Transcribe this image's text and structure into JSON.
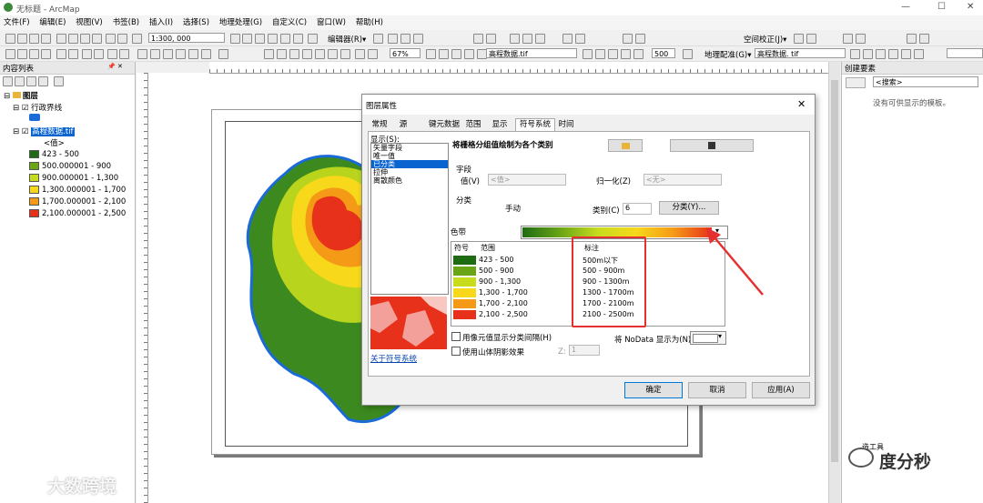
{
  "window": {
    "title": "无标题 - ArcMap",
    "minimize": "—",
    "maximize": "☐",
    "close": "✕"
  },
  "menu": [
    "文件(F)",
    "编辑(E)",
    "视图(V)",
    "书签(B)",
    "插入(I)",
    "选择(S)",
    "地理处理(G)",
    "自定义(C)",
    "窗口(W)",
    "帮助(H)"
  ],
  "toolbar": {
    "scale": "1:300, 000",
    "editor_label": "编辑器(R)▾",
    "spatial_adjust": "空间校正(J)▾",
    "zoom": "67%",
    "raster_layer": "高程数据.tif",
    "num_value": "500",
    "georef_label": "地理配准(G)▾",
    "georef_layer": "高程数据. tif"
  },
  "toc": {
    "title": "内容列表",
    "pin": "📌 ✕",
    "layers_root": "图层",
    "layer1": "行政界线",
    "layer2": "高程数据.tif",
    "value_label": "<值>",
    "classes": [
      {
        "label": "423 - 500",
        "color": "#1e6b14"
      },
      {
        "label": "500.000001 - 900",
        "color": "#6aa516"
      },
      {
        "label": "900.000001 - 1,300",
        "color": "#c8dc1e"
      },
      {
        "label": "1,300.000001 - 1,700",
        "color": "#f7d81a"
      },
      {
        "label": "1,700.000001 - 2,100",
        "color": "#f59a17"
      },
      {
        "label": "2,100.000001 - 2,500",
        "color": "#e8311a"
      }
    ]
  },
  "right_panel": {
    "title": "创建要素",
    "search_placeholder": "<搜索>",
    "empty_msg": "没有可供显示的模板。",
    "tools_label": "造工具"
  },
  "dialog": {
    "title": "图层属性",
    "close": "✕",
    "tabs": [
      "常规",
      "源",
      "键元数据",
      "范围",
      "显示",
      "符号系统",
      "时间"
    ],
    "show_label": "显示(S):",
    "show_items": [
      "矢量字段",
      "唯一值",
      "已分类",
      "拉伸",
      "离散颜色"
    ],
    "selected_show": "已分类",
    "heading": "将栅格分组值绘制为各个类别",
    "field_group": "字段",
    "value_label": "值(V)",
    "value_combo": "<值>",
    "normalize_label": "归一化(Z)",
    "normalize_combo": "<无>",
    "classify_group": "分类",
    "method": "手动",
    "classes_label": "类别(C)",
    "classes_count": "6",
    "classify_btn": "分类(Y)...",
    "ramp_label": "色带",
    "col_symbol": "符号",
    "col_range": "范围",
    "col_label": "标注",
    "rows": [
      {
        "range": "423 - 500",
        "label": "500m以下",
        "color": "#1e6b14"
      },
      {
        "range": "500 - 900",
        "label": "500 - 900m",
        "color": "#6aa516"
      },
      {
        "range": "900 - 1,300",
        "label": "900 - 1300m",
        "color": "#c8dc1e"
      },
      {
        "range": "1,300 - 1,700",
        "label": "1300 - 1700m",
        "color": "#f7d81a"
      },
      {
        "range": "1,700 - 2,100",
        "label": "1700 - 2100m",
        "color": "#f59a17"
      },
      {
        "range": "2,100 - 2,500",
        "label": "2100 - 2500m",
        "color": "#e8311a"
      }
    ],
    "chk_pixel": "用像元值显示分类间隔(H)",
    "chk_hillshade": "使用山体阴影效果",
    "z_label": "Z:",
    "z_value": "1",
    "nodata_label": "将 NoData 显示为(N)",
    "about_link": "关于符号系统",
    "ok": "确定",
    "cancel": "取消",
    "apply": "应用(A)"
  },
  "watermarks": {
    "left": "大数跨境",
    "right": "度分秒"
  }
}
